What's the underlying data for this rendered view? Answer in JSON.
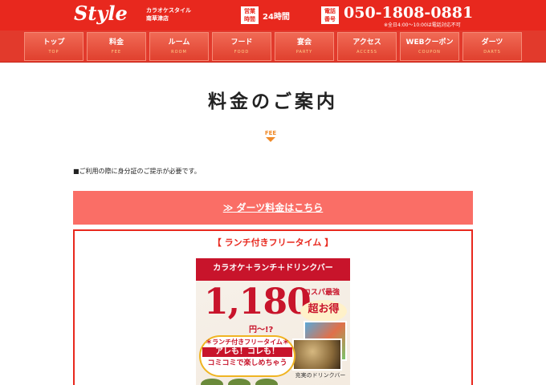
{
  "header": {
    "logo": "Style",
    "subtitle_line1": "カラオケスタイル",
    "subtitle_line2": "南草津店",
    "hours_badge_line1": "営業",
    "hours_badge_line2": "時間",
    "hours": "24時間",
    "tel_badge_line1": "電話",
    "tel_badge_line2": "番号",
    "tel": "050-1808-0881",
    "tel_note": "※全日4:00～10:00は電話対応不可",
    "brand_color": "#e8281e"
  },
  "nav": {
    "items": [
      {
        "label": "トップ",
        "en": "TOP"
      },
      {
        "label": "料金",
        "en": "FEE"
      },
      {
        "label": "ルーム",
        "en": "ROOM"
      },
      {
        "label": "フード",
        "en": "FOOD"
      },
      {
        "label": "宴会",
        "en": "PARTY"
      },
      {
        "label": "アクセス",
        "en": "ACCESS"
      },
      {
        "label": "WEBクーポン",
        "en": "COUPON"
      },
      {
        "label": "ダーツ",
        "en": "DARTS"
      }
    ]
  },
  "main": {
    "title": "料金のご案内",
    "title_en": "FEE",
    "notice": "■ご利用の際に身分証のご提示が必要です。",
    "darts_link": "≫ ダーツ料金はこちら",
    "lunch_title": "【 ランチ付きフリータイム 】",
    "accent_color": "#fa6e66"
  },
  "promo": {
    "headline": "カラオケ＋ランチ＋ドリンクバー",
    "price": "1,180",
    "price_suffix": "円～!?",
    "cospa": "コスパ最強",
    "otoku": "超お得",
    "lunch_free": "＊ランチ付きフリータイム＊",
    "aremo": "アレも！コレも！",
    "komikomi": "コミコミで楽しめちゃう",
    "drinkbar": "充実のドリンクバー",
    "promo_color": "#c8142b"
  }
}
